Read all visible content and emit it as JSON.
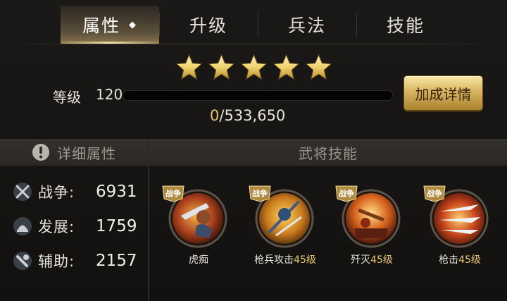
{
  "tabs": [
    {
      "label": "属性",
      "active": true
    },
    {
      "label": "升级",
      "active": false
    },
    {
      "label": "兵法",
      "active": false
    },
    {
      "label": "技能",
      "active": false
    }
  ],
  "stars": {
    "count": 5,
    "filled": 5,
    "color": "#f2d87a"
  },
  "level": {
    "label": "等级",
    "value": "120"
  },
  "exp": {
    "current": "0",
    "total": "/533,650",
    "progress": 0
  },
  "detail_button": {
    "label": "加成详情"
  },
  "attributes": {
    "header": "详细属性",
    "items": [
      {
        "icon": "crossed-swords-icon",
        "name": "战争:",
        "value": "6931"
      },
      {
        "icon": "development-icon",
        "name": "发展:",
        "value": "1759"
      },
      {
        "icon": "assist-icon",
        "name": "辅助:",
        "value": "2157"
      }
    ]
  },
  "skills": {
    "header": "武将技能",
    "tag": "战争",
    "items": [
      {
        "name": "虎痴",
        "level": ""
      },
      {
        "name": "枪兵攻击",
        "level": "45级"
      },
      {
        "name": "歼灭",
        "level": "45级"
      },
      {
        "name": "枪击",
        "level": "45级"
      }
    ]
  },
  "colors": {
    "gold": "#e7c56a",
    "accent": "#d9b560",
    "bg": "#141211"
  }
}
